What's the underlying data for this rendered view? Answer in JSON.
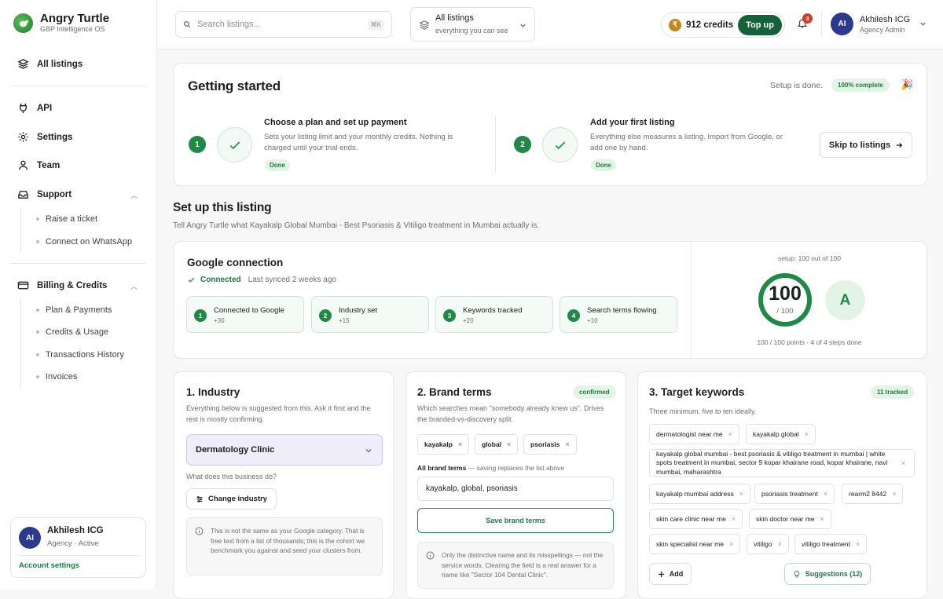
{
  "app": {
    "name": "Angry Turtle",
    "subtitle": "GBP Intelligence OS"
  },
  "sidebar": {
    "all_listings": "All listings",
    "api": "API",
    "settings": "Settings",
    "team": "Team",
    "support": {
      "label": "Support",
      "items": [
        "Raise a ticket",
        "Connect on WhatsApp"
      ]
    },
    "billing": {
      "label": "Billing & Credits",
      "items": [
        "Plan & Payments",
        "Credits & Usage",
        "Transactions History",
        "Invoices"
      ]
    },
    "user": {
      "initials": "AI",
      "name": "Akhilesh ICG",
      "role": "Agency · Active",
      "account_link": "Account settings"
    }
  },
  "topbar": {
    "search_placeholder": "Search listings...",
    "search_shortcut": "⌘K",
    "listing_selector": {
      "title": "All listings",
      "sub": "everything you can see"
    },
    "credits": {
      "symbol": "₹",
      "amount": "912 credits",
      "topup": "Top up"
    },
    "notifications": "3",
    "user": {
      "initials": "AI",
      "name": "Akhilesh ICG",
      "role": "Agency Admin"
    }
  },
  "getting_started": {
    "title": "Getting started",
    "status": "Setup is done.",
    "badge": "100% complete",
    "steps": [
      {
        "num": "1",
        "title": "Choose a plan and set up payment",
        "desc": "Sets your listing limit and your monthly credits. Nothing is charged until your trial ends.",
        "badge": "Done"
      },
      {
        "num": "2",
        "title": "Add your first listing",
        "desc": "Everything else measures a listing. Import from Google, or add one by hand.",
        "badge": "Done"
      }
    ],
    "skip_button": "Skip to listings"
  },
  "setup": {
    "title": "Set up this listing",
    "subtitle": "Tell Angry Turtle what Kayakalp Global Mumbai - Best Psoriasis & Vitiligo treatment in Mumbai actually is."
  },
  "google": {
    "title": "Google connection",
    "status": "Connected",
    "synced": "Last synced 2 weeks ago",
    "steps": [
      {
        "num": "1",
        "label": "Connected to Google",
        "points": "+30"
      },
      {
        "num": "2",
        "label": "Industry set",
        "points": "+15"
      },
      {
        "num": "3",
        "label": "Keywords tracked",
        "points": "+20"
      },
      {
        "num": "4",
        "label": "Search terms flowing",
        "points": "+10"
      }
    ],
    "score": {
      "caption": "setup: 100 out of 100",
      "value": "100",
      "max": "/ 100",
      "grade": "A",
      "footer": "100 / 100 points · 4 of 4 steps done",
      "fraction": 1.0
    }
  },
  "industry": {
    "title": "1. Industry",
    "desc": "Everything below is suggested from this. Ask it first and the rest is mostly confirming.",
    "selected": "Dermatology Clinic",
    "question": "What does this business do?",
    "change_button": "Change industry",
    "info": "This is not the same as your Google category. That is free text from a list of thousands; this is the cohort we benchmark you against and seed your clusters from."
  },
  "brand": {
    "title": "2. Brand terms",
    "badge": "confirmed",
    "desc": "Which searches mean \"somebody already knew us\". Drives the branded-vs-discovery split.",
    "chips": [
      "kayakalp",
      "global",
      "psoriasis"
    ],
    "field_label": "All brand terms",
    "field_hint": "— saving replaces the list above",
    "field_value": "kayakalp, global, psoriasis",
    "save_button": "Save brand terms",
    "info": "Only the distinctive name and its misspellings — not the service words. Clearing the field is a real answer for a name like \"Sector 104 Dental Clinic\"."
  },
  "keywords": {
    "title": "3. Target keywords",
    "badge": "11 tracked",
    "desc": "Three minimum, five to ten ideally.",
    "chips": [
      "dermatologist near me",
      "kayakalp global",
      "kayakalp global mumbai - best psoriasis & vitiligo treatment in mumbai | white spots treatment in mumbai, sector 9 kopar khairane road, kopar khairane, navi mumbai, maharashtra",
      "kayakalp mumbai address",
      "psoriasis treatment",
      "rearm2 8442",
      "skin care clinic near me",
      "skin doctor near me",
      "skin specialist near me",
      "vitiligo",
      "vitiligo treatment"
    ],
    "add_button": "Add",
    "suggestions_button": "Suggestions (12)"
  }
}
